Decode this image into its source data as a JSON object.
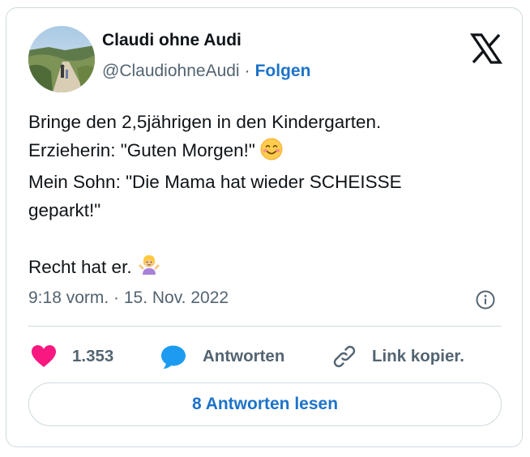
{
  "author": {
    "name": "Claudi ohne Audi",
    "handle": "@ClaudiohneAudi",
    "separator": "·",
    "follow_label": "Folgen"
  },
  "tweet": {
    "lines": [
      "Bringe den 2,5jährigen in den Kindergarten.",
      "Erzieherin: \"Guten Morgen!\"",
      "Mein Sohn: \"Die Mama hat wieder SCHEISSE",
      "geparkt!\"",
      "",
      "Recht hat er."
    ],
    "emojis": [
      "smiling-face-emoji",
      "person-shrugging-emoji"
    ],
    "timestamp": "9:18 vorm. · 15. Nov. 2022"
  },
  "actions": {
    "like_count": "1.353",
    "reply_label": "Antworten",
    "copy_label": "Link kopier."
  },
  "read_replies_label": "8 Antworten lesen",
  "icons": [
    "avatar-photo",
    "x-logo-icon",
    "info-icon",
    "heart-icon",
    "reply-bubble-icon",
    "link-icon"
  ],
  "colors": {
    "link_blue": "#1d73c9",
    "heart_red": "#f91880",
    "reply_blue": "#1d9bf0",
    "secondary_text": "#536471",
    "border": "#cfd9de"
  }
}
